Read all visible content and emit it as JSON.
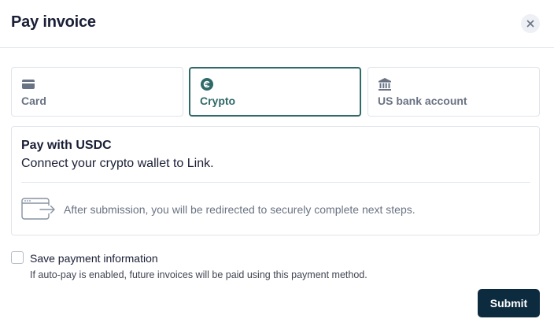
{
  "dialog": {
    "title": "Pay invoice",
    "close_icon": "close-icon"
  },
  "payment_methods": [
    {
      "label": "Card",
      "icon": "credit-card-icon",
      "selected": false
    },
    {
      "label": "Crypto",
      "icon": "crypto-coin-icon",
      "selected": true
    },
    {
      "label": "US bank account",
      "icon": "bank-icon",
      "selected": false
    }
  ],
  "crypto_panel": {
    "title": "Pay with USDC",
    "description": "Connect your crypto wallet to Link.",
    "redirect_icon": "browser-redirect-icon",
    "redirect_note": "After submission, you will be redirected to securely complete next steps."
  },
  "save_payment": {
    "checked": false,
    "label": "Save payment information",
    "help": "If auto-pay is enabled, future invoices will be paid using this payment method."
  },
  "submit_label": "Submit",
  "colors": {
    "accent": "#2f6a68",
    "submit_bg": "#0d2b3e",
    "border": "#e0e4ea",
    "muted_text": "#6a7383"
  }
}
